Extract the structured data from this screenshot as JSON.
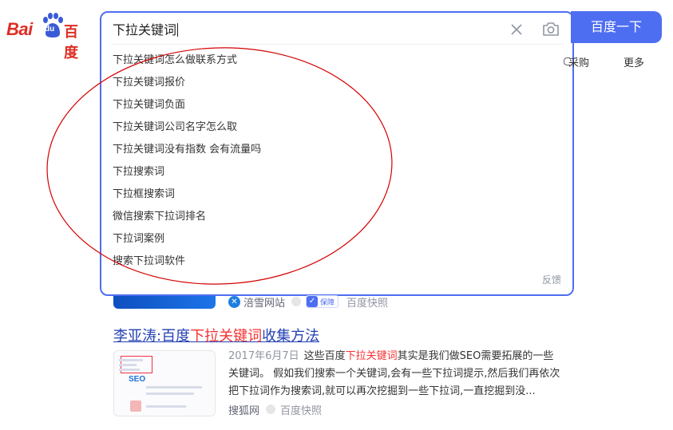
{
  "logo": {
    "text_bai": "Bai",
    "text_du": "du",
    "text_cn": "百度"
  },
  "search": {
    "query": "下拉关键词",
    "button_label": "百度一下",
    "suggestions": [
      "下拉关键词怎么做联系方式",
      "下拉关键词报价",
      "下拉关键词负面",
      "下拉关键词公司名字怎么取",
      "下拉关键词没有指数 会有流量吗",
      "下拉搜索词",
      "下拉框搜索词",
      "微信搜索下拉词排名",
      "下拉词案例",
      "搜索下拉词软件"
    ],
    "feedback_label": "反馈"
  },
  "top_links": {
    "caigou": "采购",
    "more": "更多"
  },
  "results": [
    {
      "source": "涪雪网站",
      "guarantee": "保障",
      "snapshot": "百度快照"
    },
    {
      "title_pre": "李亚涛:百度",
      "title_hl": "下拉关键词",
      "title_post": "收集方法",
      "thumb_text": "SEO",
      "date": "2017年6月7日",
      "snippet_pre": "这些百度",
      "snippet_hl": "下拉关键词",
      "snippet_post": "其实是我们做SEO需要拓展的一些关键词。 假如我们搜索一个关键词,会有一些下拉词提示,然后我们再依次把下拉词作为搜索词,就可以再次挖掘到一些下拉词,一直挖掘到没...",
      "source": "搜狐网",
      "snapshot": "百度快照"
    }
  ],
  "colors": {
    "accent": "#4e6ef2",
    "brand_red": "#de2d23",
    "highlight": "#f73131",
    "link": "#2440b3",
    "annotation": "#d40000"
  }
}
